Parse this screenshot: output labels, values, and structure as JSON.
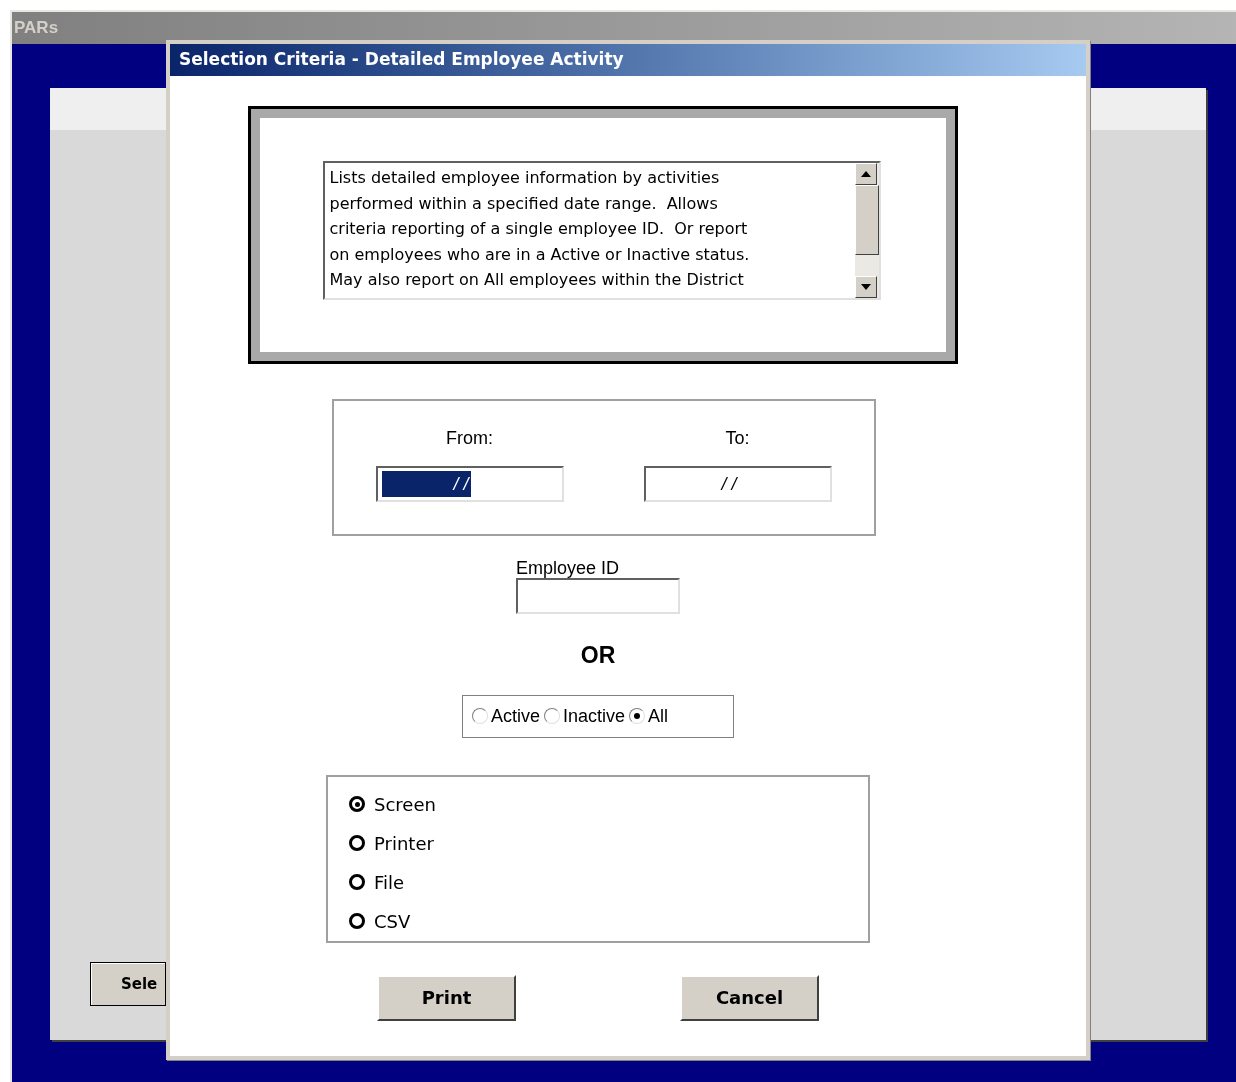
{
  "background_window": {
    "title": "PARs",
    "button": "Sele"
  },
  "dialog": {
    "title": "Selection Criteria - Detailed Employee Activity",
    "description": [
      "Lists detailed employee information by activities",
      "performed within a specified date range.  Allows",
      "criteria reporting of a single employee ID.  Or report",
      "on employees who are in a Active or Inactive status.",
      "May also report on All employees within the District"
    ],
    "date_range": [
      {
        "label": "From:",
        "value": "/ /",
        "highlighted": true
      },
      {
        "label": "To:",
        "value": "/ /",
        "highlighted": false
      }
    ],
    "employee_id": {
      "label": "Employee ID"
    },
    "or_label": "OR",
    "status_filter": [
      {
        "label": "Active",
        "selected": false
      },
      {
        "label": "Inactive",
        "selected": false
      },
      {
        "label": "All",
        "selected": true
      }
    ],
    "output_options": [
      {
        "label": "Screen",
        "selected": true
      },
      {
        "label": "Printer",
        "selected": false
      },
      {
        "label": "File",
        "selected": false
      },
      {
        "label": "CSV",
        "selected": false
      }
    ],
    "buttons": [
      "Print",
      "Cancel"
    ]
  }
}
